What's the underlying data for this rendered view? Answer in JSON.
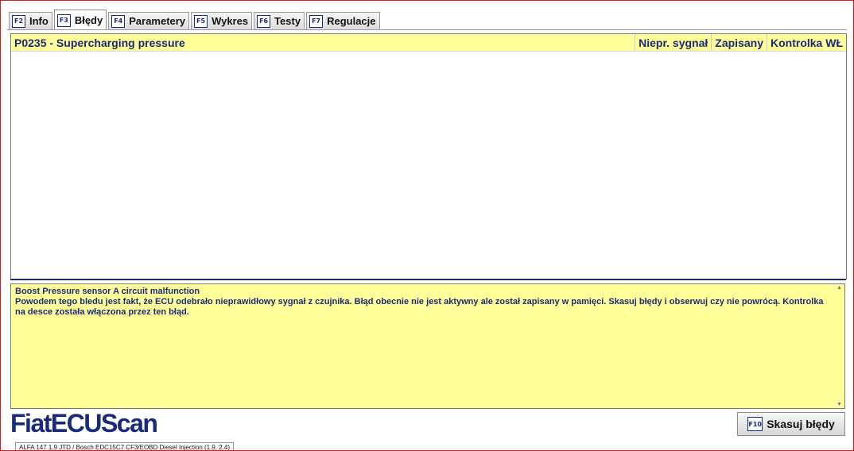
{
  "tabs": [
    {
      "key": "F2",
      "label": "Info",
      "active": false
    },
    {
      "key": "F3",
      "label": "Błędy",
      "active": true
    },
    {
      "key": "F4",
      "label": "Parametery",
      "active": false
    },
    {
      "key": "F5",
      "label": "Wykres",
      "active": false
    },
    {
      "key": "F6",
      "label": "Testy",
      "active": false
    },
    {
      "key": "F7",
      "label": "Regulacje",
      "active": false
    }
  ],
  "error_list": {
    "headers": {
      "nieprawidlowy": "Niepr. sygnał",
      "zapisany": "Zapisany",
      "kontrolka": "Kontrolka WŁ"
    },
    "rows": [
      {
        "code": "P0235 - Supercharging pressure"
      }
    ]
  },
  "description": {
    "title": "Boost Pressure sensor A circuit malfunction",
    "body": "Powodem tego bledu jest fakt, że ECU odebrało nieprawidłowy sygnał z czujnika. Błąd obecnie nie jest aktywny ale został zapisany w pamięci. Skasuj błędy i obserwuj czy nie powrócą. Kontrolka na desce została włączona przez ten błąd."
  },
  "logo": {
    "text": "FiatECUScan"
  },
  "clear_button": {
    "key": "F10",
    "label": "Skasuj błędy"
  },
  "status_bar": {
    "text": "ALFA 147 1.9 JTD / Bosch EDC15C7 CF3/EOBD Diesel Injection (1.9, 2.4)"
  },
  "colors": {
    "accent": "#1a2a7a",
    "highlight": "#ffff99",
    "frame": "#e01818"
  }
}
